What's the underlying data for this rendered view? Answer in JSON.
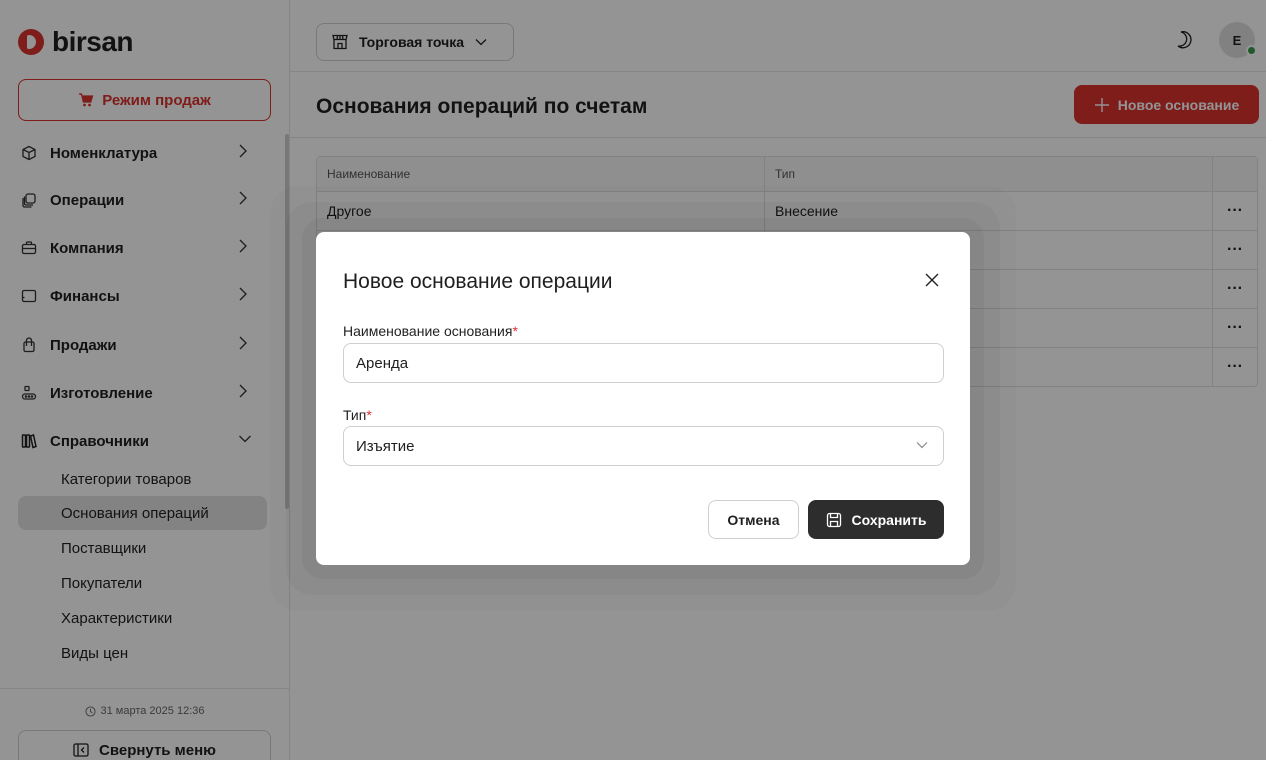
{
  "brand": {
    "name": "birsan",
    "color": "#d9322e"
  },
  "sidebar": {
    "sales_mode": "Режим продаж",
    "items": [
      {
        "label": "Номенклатура",
        "icon": "box-icon"
      },
      {
        "label": "Операции",
        "icon": "layers-icon"
      },
      {
        "label": "Компания",
        "icon": "briefcase-icon"
      },
      {
        "label": "Финансы",
        "icon": "wallet-icon"
      },
      {
        "label": "Продажи",
        "icon": "shopping-bag-icon"
      },
      {
        "label": "Изготовление",
        "icon": "factory-icon"
      },
      {
        "label": "Справочники",
        "icon": "books-icon",
        "expanded": true
      }
    ],
    "sub_items": [
      {
        "label": "Категории товаров"
      },
      {
        "label": "Основания операций",
        "active": true
      },
      {
        "label": "Поставщики"
      },
      {
        "label": "Покупатели"
      },
      {
        "label": "Характеристики"
      },
      {
        "label": "Виды цен"
      }
    ],
    "datetime": "31 марта 2025 12:36",
    "collapse_label": "Свернуть меню"
  },
  "header": {
    "store_select": "Торговая точка",
    "avatar_letter": "E"
  },
  "page": {
    "title": "Основания операций по счетам",
    "new_button": "Новое основание"
  },
  "table": {
    "columns": [
      "Наименование",
      "Тип"
    ],
    "rows": [
      {
        "name": "Другое",
        "type": "Внесение"
      },
      {
        "name": "",
        "type": ""
      },
      {
        "name": "",
        "type": ""
      },
      {
        "name": "",
        "type": ""
      },
      {
        "name": "",
        "type": ""
      }
    ],
    "row_menu": "···"
  },
  "modal": {
    "title": "Новое основание операции",
    "name_label": "Наименование основания",
    "name_value": "Аренда",
    "type_label": "Тип",
    "type_value": "Изъятие",
    "required_mark": "*",
    "cancel": "Отмена",
    "save": "Сохранить"
  }
}
